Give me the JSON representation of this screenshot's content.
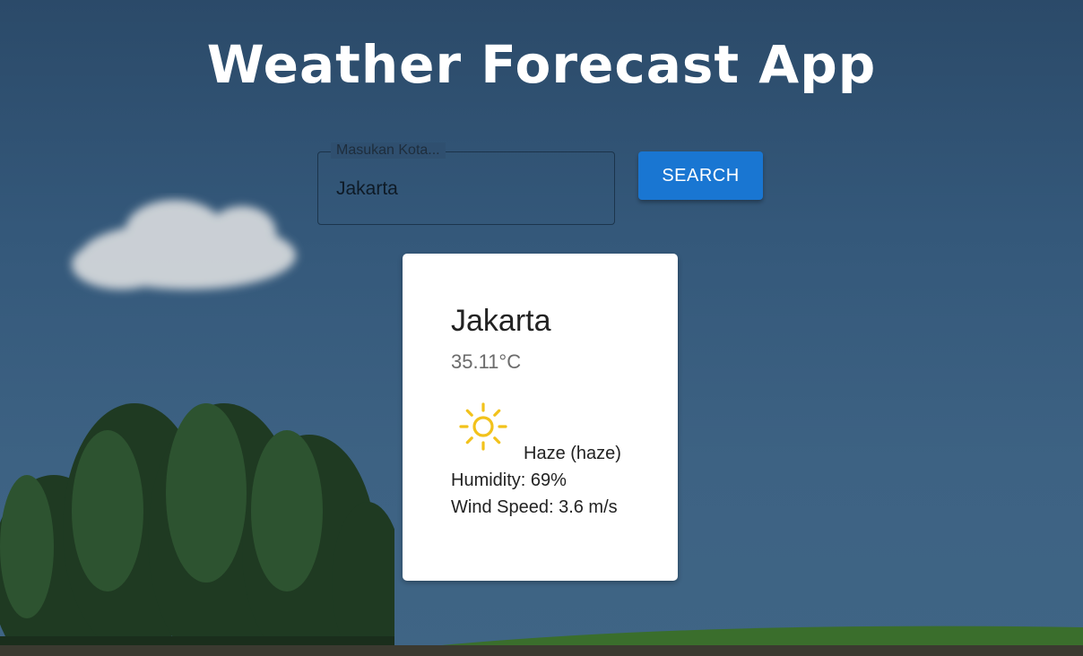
{
  "app": {
    "title": "Weather Forecast App"
  },
  "search": {
    "label": "Masukan Kota...",
    "value": "Jakarta",
    "button_label": "SEARCH"
  },
  "weather": {
    "city": "Jakarta",
    "temperature": "35.11°C",
    "icon": "sun-icon",
    "description": "Haze (haze)",
    "humidity": "Humidity: 69%",
    "wind_speed": "Wind Speed: 3.6 m/s"
  },
  "colors": {
    "accent": "#1976d2",
    "sun": "#f2c21b",
    "card": "#ffffff"
  }
}
